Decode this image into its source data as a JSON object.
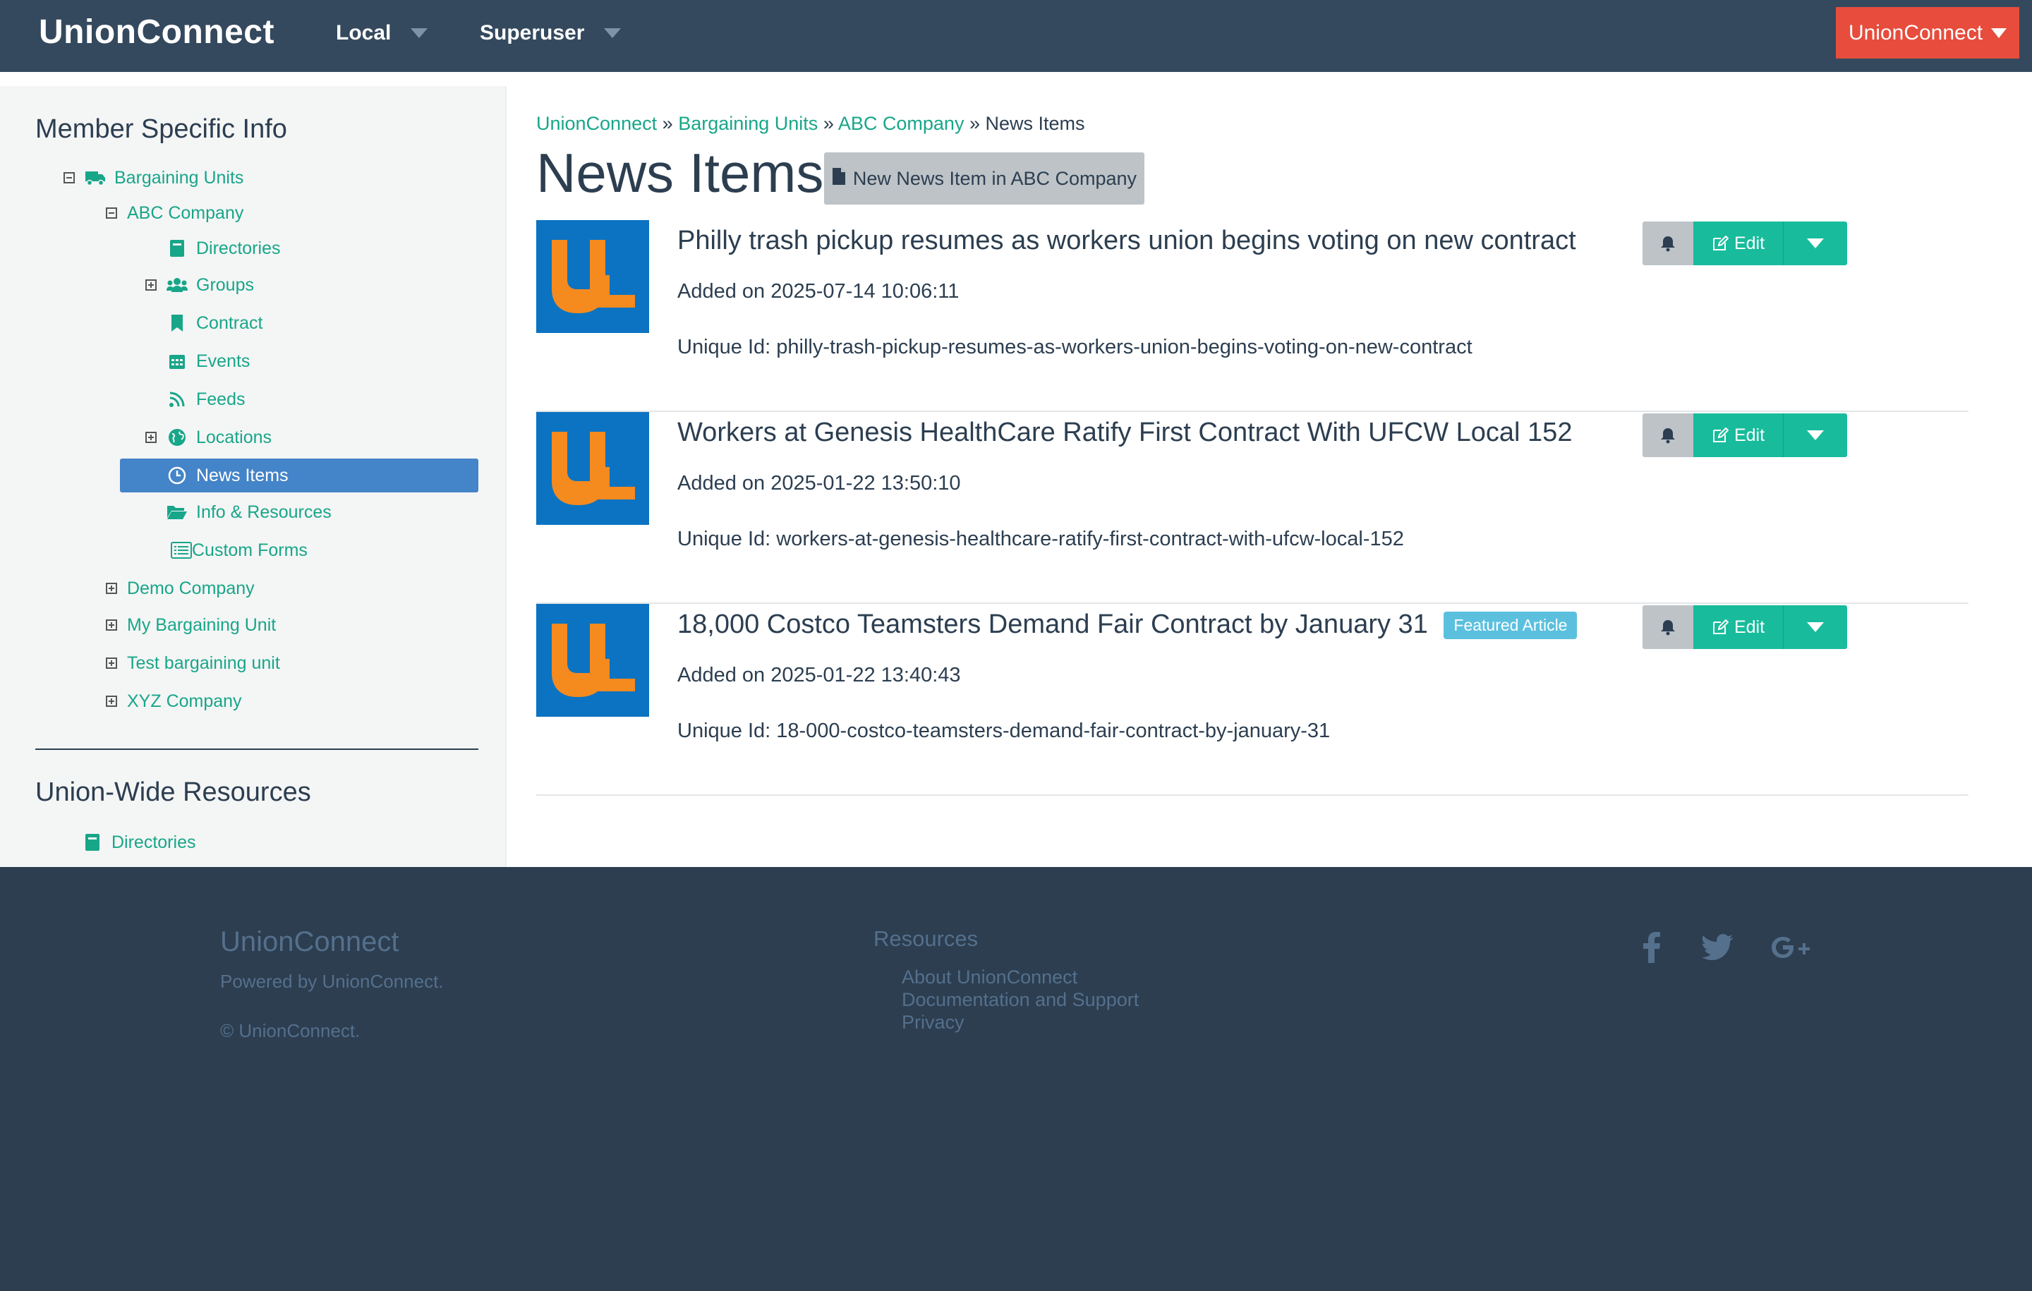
{
  "navbar": {
    "brand": "UnionConnect",
    "local_label": "Local",
    "superuser_label": "Superuser",
    "user_menu_label": "UnionConnect"
  },
  "sidebar": {
    "member_heading": "Member Specific Info",
    "union_heading": "Union-Wide Resources",
    "tree": {
      "bargaining_units": "Bargaining Units",
      "abc_company": "ABC Company",
      "directories": "Directories",
      "groups": "Groups",
      "contract": "Contract",
      "events": "Events",
      "feeds": "Feeds",
      "locations": "Locations",
      "news_items": "News Items",
      "info_resources": "Info & Resources",
      "custom_forms": "Custom Forms",
      "demo_company": "Demo Company",
      "my_bargaining_unit": "My Bargaining Unit",
      "test_bargaining_unit": "Test bargaining unit",
      "xyz_company": "XYZ Company"
    },
    "union_wide": {
      "directories": "Directories"
    }
  },
  "breadcrumb": {
    "items": [
      "UnionConnect",
      "Bargaining Units",
      "ABC Company"
    ],
    "separator": "»",
    "current": "News Items"
  },
  "page": {
    "title": "News Items",
    "new_button": "New News Item in ABC Company"
  },
  "news": [
    {
      "title": "Philly trash pickup resumes as workers union begins voting on new contract",
      "added": "Added on 2025-07-14 10:06:11",
      "uid": "Unique Id: philly-trash-pickup-resumes-as-workers-union-begins-voting-on-new-contract",
      "badge": ""
    },
    {
      "title": "Workers at Genesis HealthCare Ratify First Contract With UFCW Local 152",
      "added": "Added on 2025-01-22 13:50:10",
      "uid": "Unique Id: workers-at-genesis-healthcare-ratify-first-contract-with-ufcw-local-152",
      "badge": ""
    },
    {
      "title": "18,000 Costco Teamsters Demand Fair Contract by January 31",
      "added": "Added on 2025-01-22 13:40:43",
      "uid": "Unique Id: 18-000-costco-teamsters-demand-fair-contract-by-january-31",
      "badge": "Featured Article"
    }
  ],
  "item_actions": {
    "edit_label": "Edit"
  },
  "footer": {
    "brand": "UnionConnect",
    "powered": "Powered by UnionConnect.",
    "copyright": "© UnionConnect.",
    "resources_title": "Resources",
    "links": [
      "About UnionConnect",
      "Documentation and Support",
      "Privacy"
    ],
    "social_icons": [
      "facebook-icon",
      "twitter-icon",
      "google-plus-icon"
    ]
  },
  "colors": {
    "navbar": "#34495e",
    "accent": "#18bc9c",
    "link": "#18a689",
    "danger": "#e74c3c",
    "active": "#4484c8",
    "footer": "#2c3e50",
    "badge": "#5bc0de"
  }
}
